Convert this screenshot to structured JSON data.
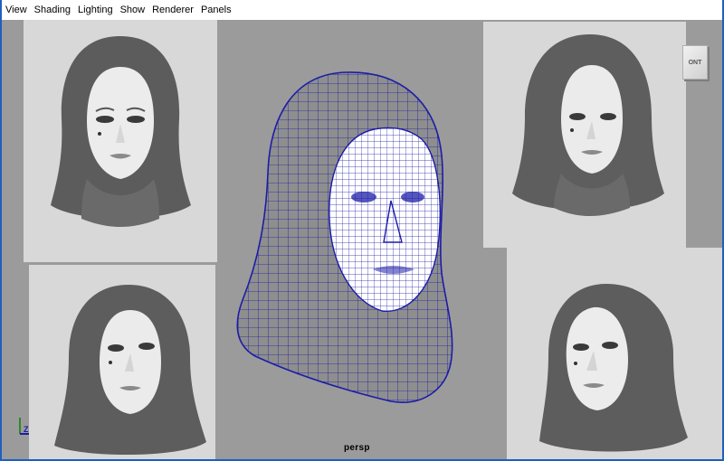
{
  "menubar": {
    "items": [
      "View",
      "Shading",
      "Lighting",
      "Show",
      "Renderer",
      "Panels"
    ]
  },
  "viewport": {
    "camera_label": "persp",
    "viewcube_label": "ONT",
    "axis_label": "Z"
  },
  "colors": {
    "viewport_bg": "#9b9b9b",
    "panel_bg": "#d8d8d8",
    "wire_color": "#1c1ca8",
    "frame": "#1f5fbf"
  },
  "icons": {
    "axis_gizmo": "axis-gizmo-icon",
    "viewcube": "viewcube-icon"
  }
}
